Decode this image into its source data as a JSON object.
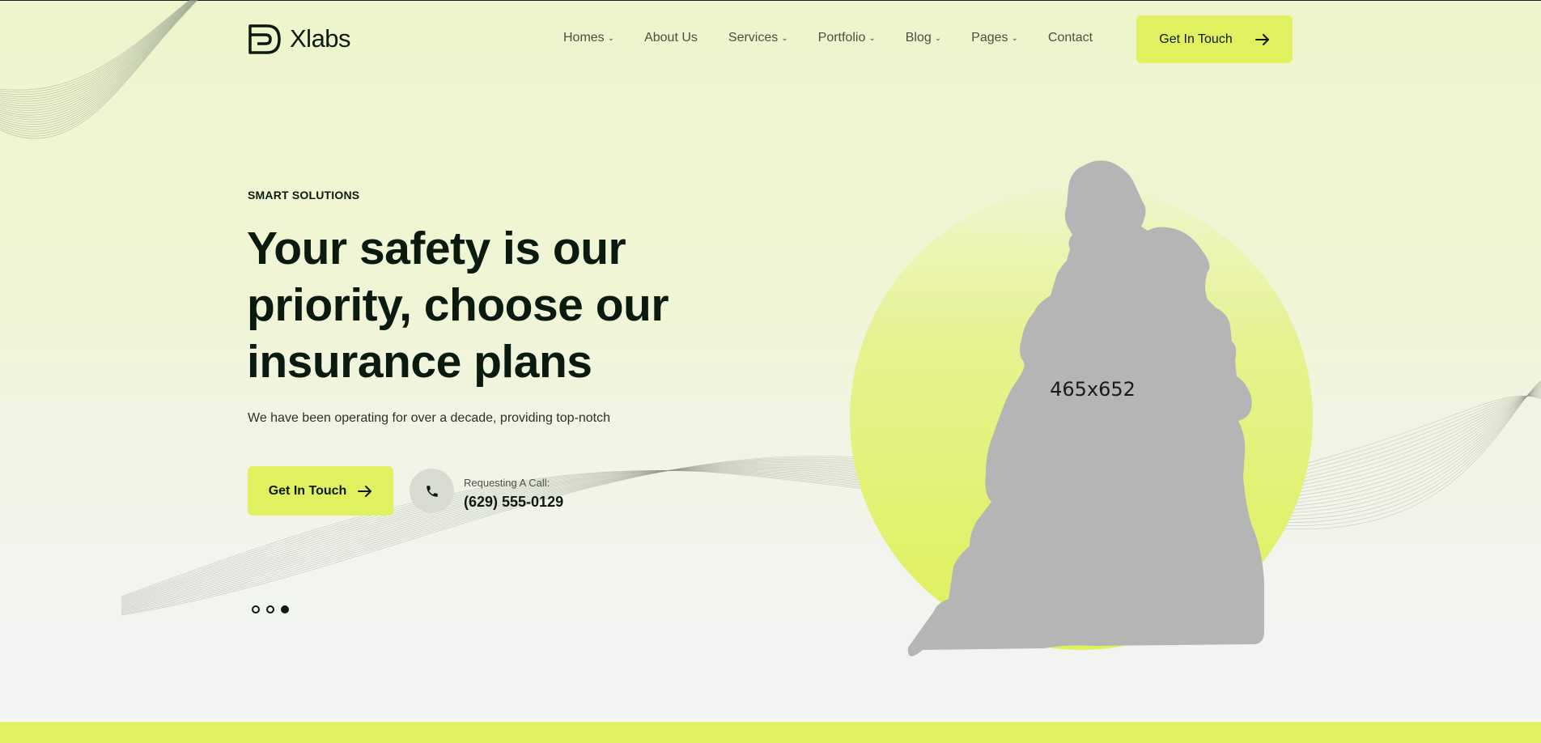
{
  "brand": {
    "name": "Xlabs",
    "icon": "xlabs-logo-icon"
  },
  "nav": {
    "items": [
      {
        "label": "Homes",
        "has_dropdown": true
      },
      {
        "label": "About Us",
        "has_dropdown": false
      },
      {
        "label": "Services",
        "has_dropdown": true
      },
      {
        "label": "Portfolio",
        "has_dropdown": true
      },
      {
        "label": "Blog",
        "has_dropdown": true
      },
      {
        "label": "Pages",
        "has_dropdown": true
      },
      {
        "label": "Contact",
        "has_dropdown": false
      }
    ],
    "cta_label": "Get In Touch",
    "cta_icon": "arrow-right-icon"
  },
  "hero": {
    "eyebrow": "SMART SOLUTIONS",
    "headline": "Your safety is our priority, choose our insurance plans",
    "subtext": "We have been operating for over a decade, providing top-notch",
    "cta_label": "Get In Touch",
    "call_label": "Requesting A Call:",
    "call_number": "(629) 555-0129",
    "phone_icon": "phone-icon",
    "image_placeholder": "465x652",
    "slider": {
      "count": 3,
      "active_index": 2
    }
  },
  "colors": {
    "accent": "#e0f05e",
    "text_dark": "#0c1a10",
    "placeholder_gray": "#b5b5b5"
  }
}
